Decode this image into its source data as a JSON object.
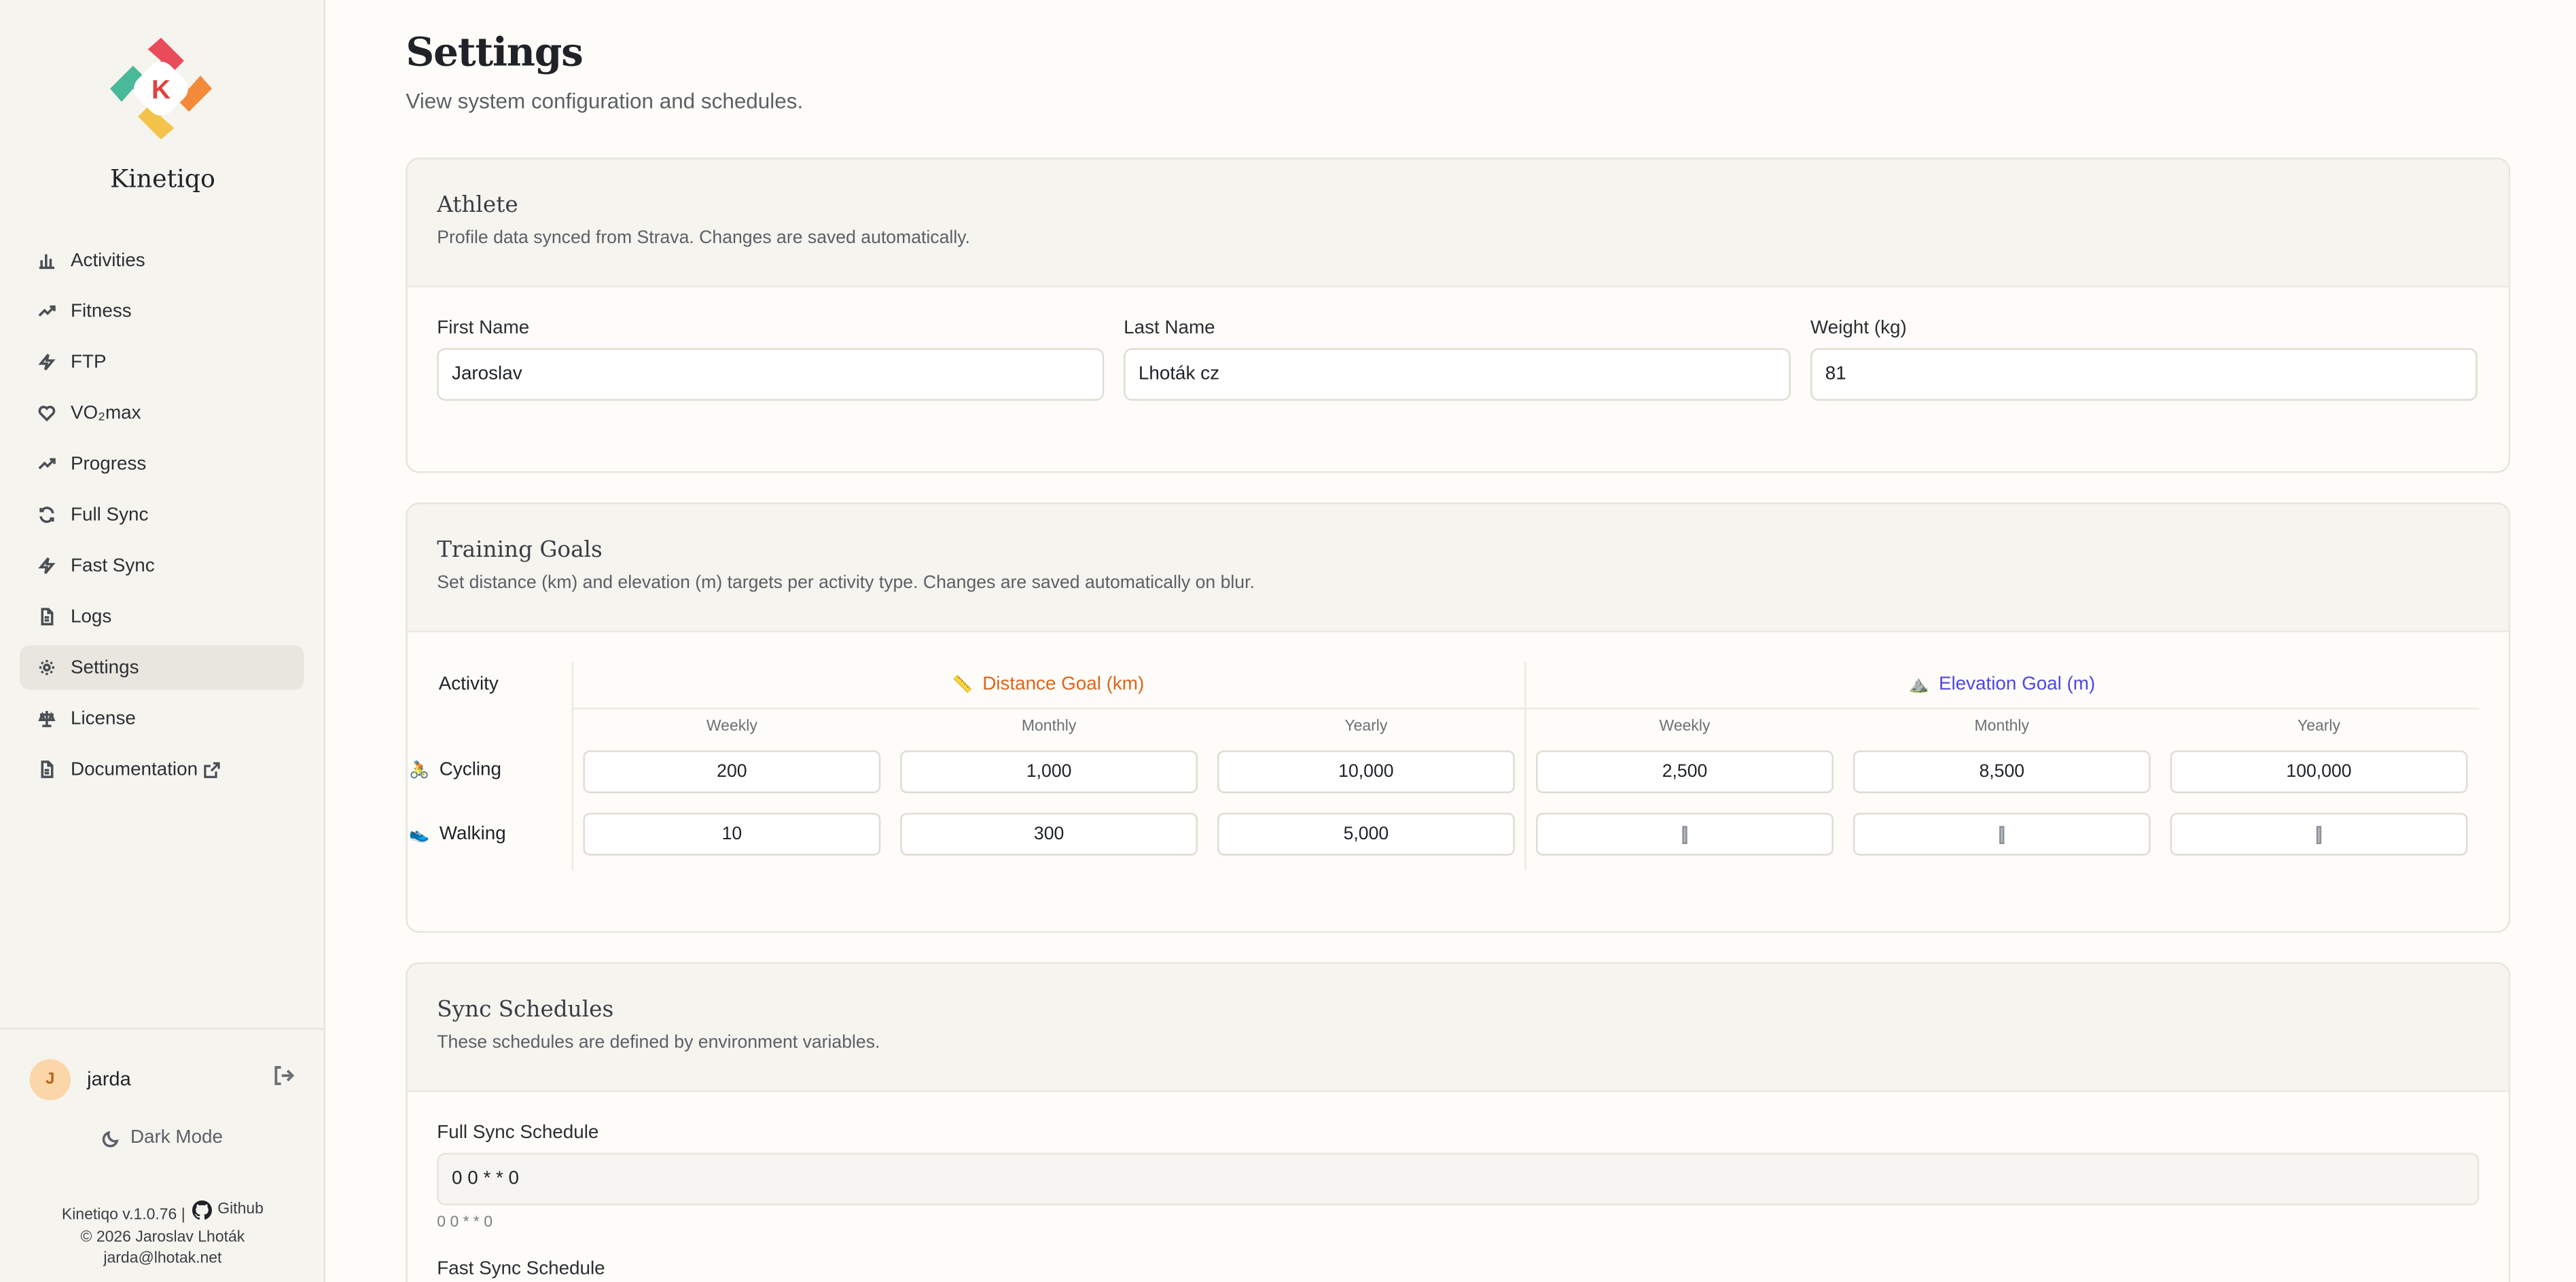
{
  "app": {
    "brand": "Kinetiqo",
    "logo_letter": "K"
  },
  "sidebar": {
    "items": [
      {
        "label": "Activities",
        "icon": "bar-chart-icon"
      },
      {
        "label": "Fitness",
        "icon": "trending-up-icon"
      },
      {
        "label": "FTP",
        "icon": "bolt-icon"
      },
      {
        "label": "VO₂max",
        "icon": "heart-icon"
      },
      {
        "label": "Progress",
        "icon": "trending-up-icon"
      },
      {
        "label": "Full Sync",
        "icon": "refresh-icon"
      },
      {
        "label": "Fast Sync",
        "icon": "bolt-icon"
      },
      {
        "label": "Logs",
        "icon": "file-icon"
      },
      {
        "label": "Settings",
        "icon": "gear-icon",
        "active": true
      },
      {
        "label": "License",
        "icon": "scale-icon"
      },
      {
        "label": "Documentation",
        "icon": "file-icon",
        "external": true
      }
    ],
    "user": {
      "initial": "J",
      "name": "jarda"
    },
    "dark_mode_label": "Dark Mode",
    "footer": {
      "version": "Kinetiqo v.1.0.76 |",
      "github": "Github",
      "copyright": "© 2026 Jaroslav Lhoták",
      "email": "jarda@lhotak.net"
    }
  },
  "page": {
    "title": "Settings",
    "subtitle": "View system configuration and schedules."
  },
  "athlete": {
    "title": "Athlete",
    "description": "Profile data synced from Strava. Changes are saved automatically.",
    "fields": [
      {
        "label": "First Name",
        "value": "Jaroslav"
      },
      {
        "label": "Last Name",
        "value": "Lhoták cz"
      },
      {
        "label": "Weight (kg)",
        "value": "81"
      }
    ]
  },
  "goals": {
    "title": "Training Goals",
    "description": "Set distance (km) and elevation (m) targets per activity type. Changes are saved automatically on blur.",
    "activity_header": "Activity",
    "distance_header": "Distance Goal (km)",
    "distance_emoji": "📏",
    "elevation_header": "Elevation Goal (m)",
    "elevation_emoji": "⛰️",
    "periods": [
      "Weekly",
      "Monthly",
      "Yearly",
      "Weekly",
      "Monthly",
      "Yearly"
    ],
    "rows": [
      {
        "emoji": "🚴",
        "label": "Cycling",
        "values": [
          "200",
          "1,000",
          "10,000",
          "2,500",
          "8,500",
          "100,000"
        ]
      },
      {
        "emoji": "👟",
        "label": "Walking",
        "values": [
          "10",
          "300",
          "5,000",
          "",
          "",
          ""
        ]
      }
    ],
    "colors": {
      "distance": "#e0641b",
      "elevation": "#4f46e5"
    }
  },
  "sync": {
    "title": "Sync Schedules",
    "description": "These schedules are defined by environment variables.",
    "full_label": "Full Sync Schedule",
    "full_value": "0 0 * * 0",
    "full_hint": "0 0 * * 0",
    "fast_label": "Fast Sync Schedule"
  }
}
